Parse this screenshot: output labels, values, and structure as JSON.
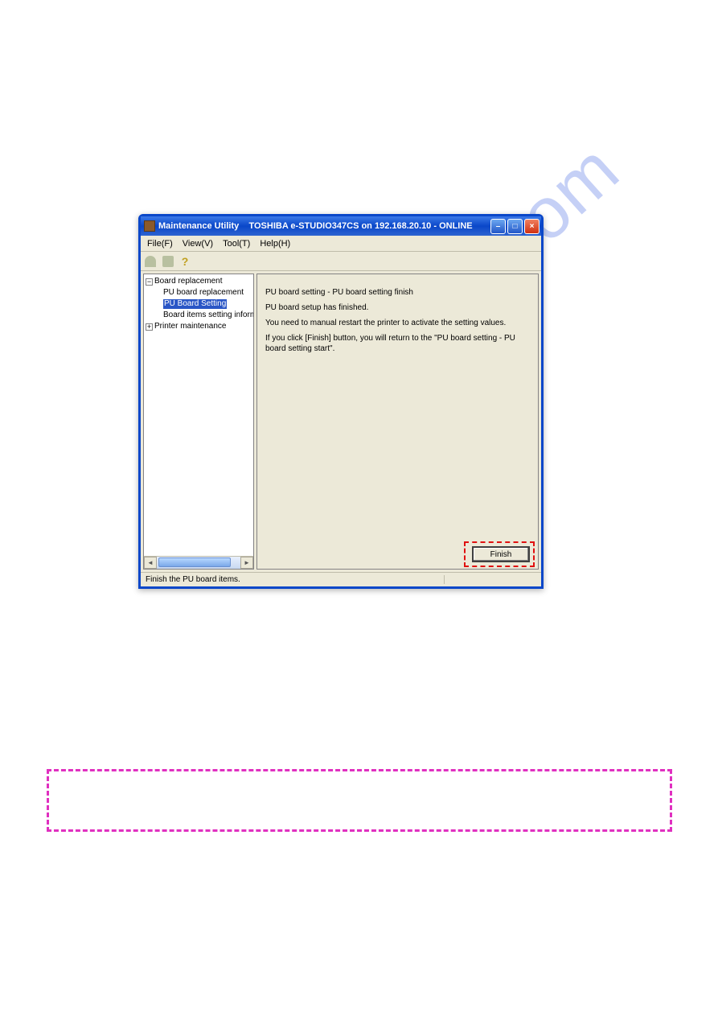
{
  "watermark": "manualshive.com",
  "window": {
    "app_name": "Maintenance Utility",
    "title_suffix": "TOSHIBA e-STUDIO347CS on 192.168.20.10  - ONLINE"
  },
  "menu": {
    "file": "File(F)",
    "view": "View(V)",
    "tool": "Tool(T)",
    "help": "Help(H)"
  },
  "tree": {
    "node0": {
      "label": "Board replacement",
      "toggle": "−"
    },
    "node0_0": {
      "label": "PU board replacement"
    },
    "node0_1": {
      "label": "PU Board Setting"
    },
    "node0_2": {
      "label": "Board items setting informa"
    },
    "node1": {
      "label": "Printer maintenance",
      "toggle": "+"
    }
  },
  "content": {
    "heading": "PU board setting - PU board setting finish",
    "line1": "PU board setup has finished.",
    "line2": "You need to manual restart the printer to activate the setting values.",
    "line3": "If you click [Finish] button, you will return to the \"PU board setting - PU board setting start\"."
  },
  "buttons": {
    "finish": "Finish"
  },
  "statusbar": {
    "text": "Finish the PU board items."
  },
  "scroll": {
    "left_arrow": "◄",
    "right_arrow": "►"
  },
  "window_controls": {
    "min": "–",
    "max": "□",
    "close": "×"
  }
}
